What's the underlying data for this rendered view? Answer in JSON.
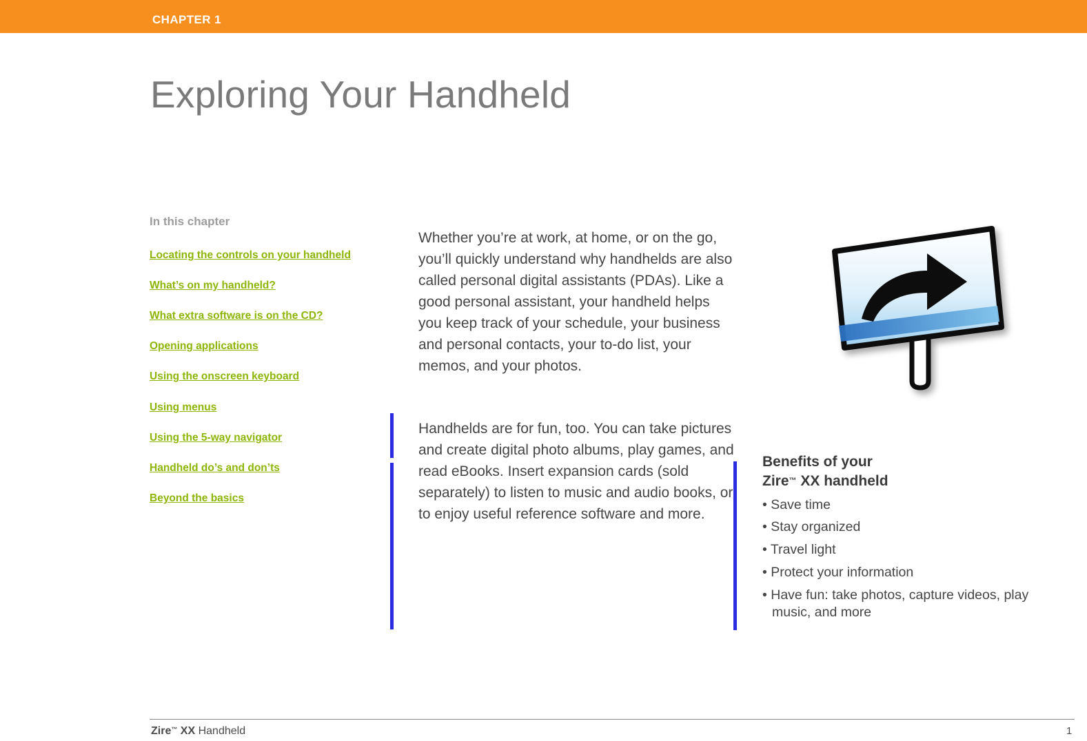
{
  "header": {
    "chapter_label": "CHAPTER 1",
    "bar_color": "#F78F1E"
  },
  "page_title": "Exploring Your Handheld",
  "toc": {
    "heading": "In this chapter",
    "link_color": "#8CB504",
    "items": [
      "Locating the controls on your handheld",
      "What’s on my handheld?",
      "What extra software is on the CD?",
      "Opening applications",
      "Using the onscreen keyboard",
      "Using menus",
      "Using the 5-way navigator",
      "Handheld do’s and don’ts",
      "Beyond the basics"
    ]
  },
  "body": {
    "paragraph_1": "Whether you’re at work, at home, or on the go, you’ll quickly understand why handhelds are also called personal digital assistants (PDAs). Like a good personal assistant, your handheld helps you keep track of your schedule, your business and personal contacts, your to-do list, your memos, and your photos.",
    "paragraph_2": "Handhelds are for fun, too. You can take pictures and create digital photo albums, play games, and read eBooks. Insert expansion cards (sold separately) to listen to music and audio books, or to enjoy useful reference software and more.",
    "rule_color": "#2B2BE0"
  },
  "benefits": {
    "title_line_1": "Benefits of your",
    "title_brand": "Zire",
    "title_tm": "™",
    "title_model": "XX  handheld",
    "items": [
      "• Save time",
      "• Stay organized",
      "• Travel light",
      "• Protect your information",
      "• Have fun: take photos, capture videos, play music, and more"
    ]
  },
  "illustration": {
    "name": "signpost-arrow-illustration"
  },
  "footer": {
    "brand": "Zire",
    "tm": "™",
    "model": "XX",
    "product": "Handheld",
    "page_number": "1"
  }
}
